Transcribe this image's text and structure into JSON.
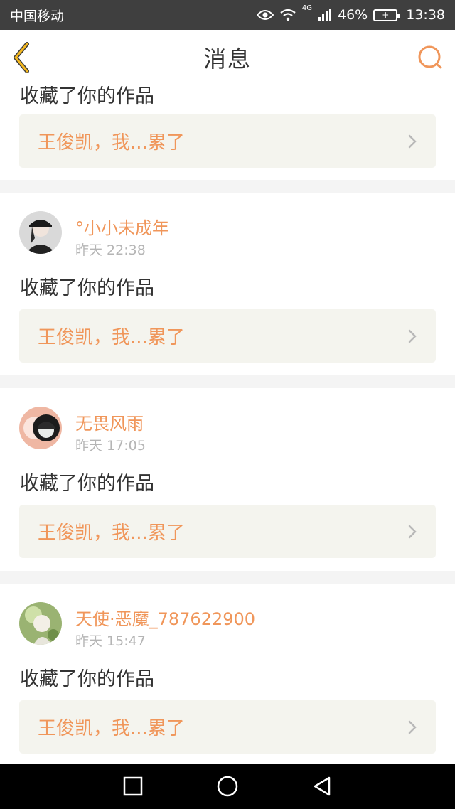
{
  "status_bar": {
    "carrier": "中国移动",
    "network": "4G",
    "battery_percent": "46%",
    "time": "13:38",
    "icons": [
      "eye-icon",
      "wifi-icon",
      "signal-icon",
      "battery-icon"
    ]
  },
  "header": {
    "title": "消息",
    "back_icon": "chevron-left-icon",
    "search_icon": "search-icon"
  },
  "messages": [
    {
      "username": "",
      "time": "",
      "action": "收藏了你的作品",
      "work_title": "王俊凯，我...累了"
    },
    {
      "username": "°小小未成年",
      "time": "昨天 22:38",
      "action": "收藏了你的作品",
      "work_title": "王俊凯，我...累了"
    },
    {
      "username": "无畏风雨",
      "time": "昨天 17:05",
      "action": "收藏了你的作品",
      "work_title": "王俊凯，我...累了"
    },
    {
      "username": "天使·恶魔_787622900",
      "time": "昨天 15:47",
      "action": "收藏了你的作品",
      "work_title": "王俊凯，我...累了"
    }
  ],
  "colors": {
    "accent": "#f0965a",
    "back_icon": "#f5b81e",
    "status_bar_bg": "#3f3f3f",
    "work_box_bg": "#f4f4ee",
    "divider_bg": "#f4f4f4"
  },
  "system_nav": [
    "recent-apps-icon",
    "home-icon",
    "back-icon"
  ]
}
